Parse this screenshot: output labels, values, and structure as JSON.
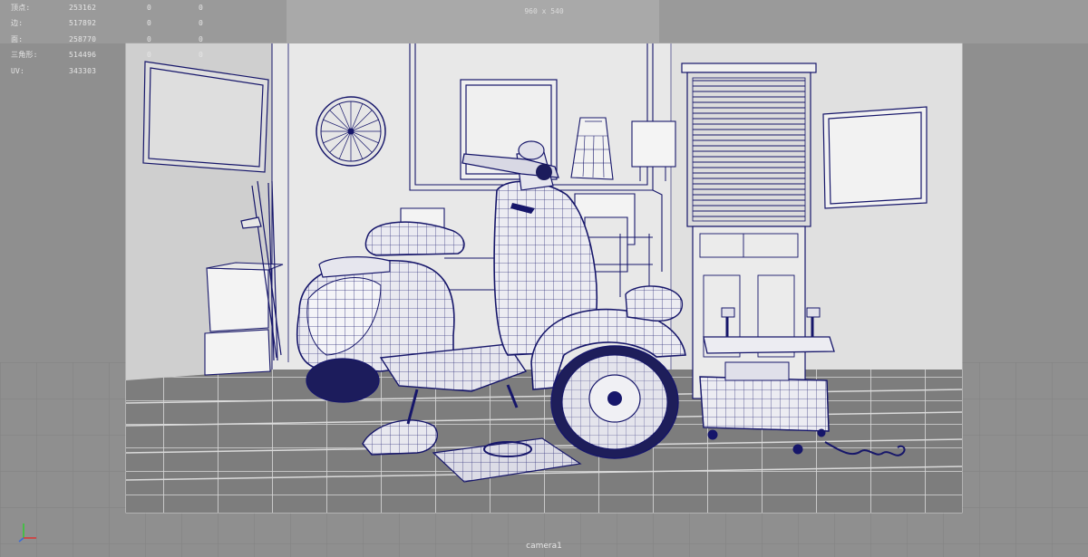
{
  "hud": {
    "rows": [
      {
        "label": "顶点:",
        "values": [
          "253162",
          "0",
          "0"
        ]
      },
      {
        "label": "边:",
        "values": [
          "517892",
          "0",
          "0"
        ]
      },
      {
        "label": "面:",
        "values": [
          "258770",
          "0",
          "0"
        ]
      },
      {
        "label": "三角形:",
        "values": [
          "514496",
          "0",
          "0"
        ]
      },
      {
        "label": "UV:",
        "values": [
          "343303",
          "0",
          "0"
        ]
      }
    ]
  },
  "viewport": {
    "resolution_label": "960 x 540",
    "camera_label": "camera1",
    "wire_color": "#16166a",
    "gate_color": "#d4d4d4"
  },
  "icons": {
    "axis": "axis-gizmo-icon"
  }
}
